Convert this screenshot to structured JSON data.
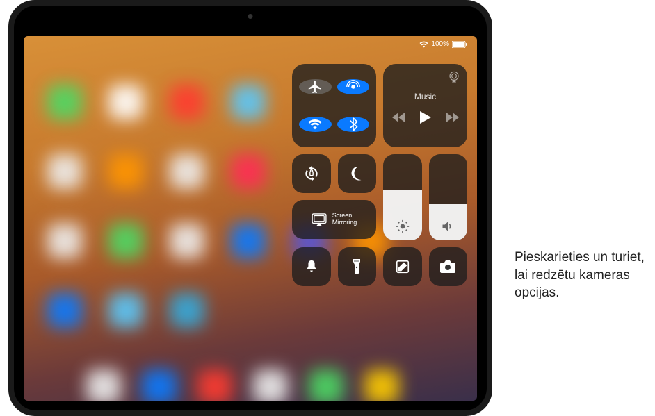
{
  "status": {
    "battery_percent": "100%"
  },
  "control_center": {
    "music": {
      "label": "Music"
    },
    "screen_mirror": {
      "label": "Screen\nMirroring"
    }
  },
  "callout": {
    "text": "Pieskarieties un turiet, lai redzētu kameras opcijas."
  }
}
